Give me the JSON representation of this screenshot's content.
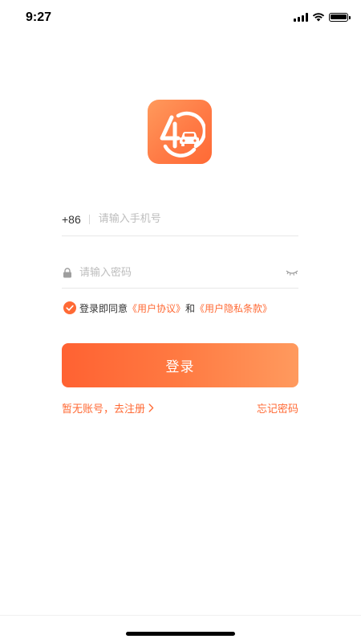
{
  "status_bar": {
    "time": "9:27"
  },
  "login": {
    "country_code": "+86",
    "phone_placeholder": "请输入手机号",
    "password_placeholder": "请输入密码",
    "agreement_prefix": "登录即同意",
    "user_agreement": "《用户协议》",
    "and": "和",
    "privacy_policy": "《用户隐私条款》",
    "agreement_checked": true,
    "login_button": "登录",
    "register_link": "暂无账号，去注册",
    "forgot_password": "忘记密码"
  },
  "colors": {
    "accent": "#ff6a35",
    "button_gradient_start": "#ff6232",
    "button_gradient_end": "#ff9a5e"
  },
  "icons": {
    "logo": "logo-icon",
    "lock": "lock-icon",
    "eye": "eye-closed-icon",
    "check": "check-circle-icon",
    "chevron": "chevron-right-icon"
  }
}
